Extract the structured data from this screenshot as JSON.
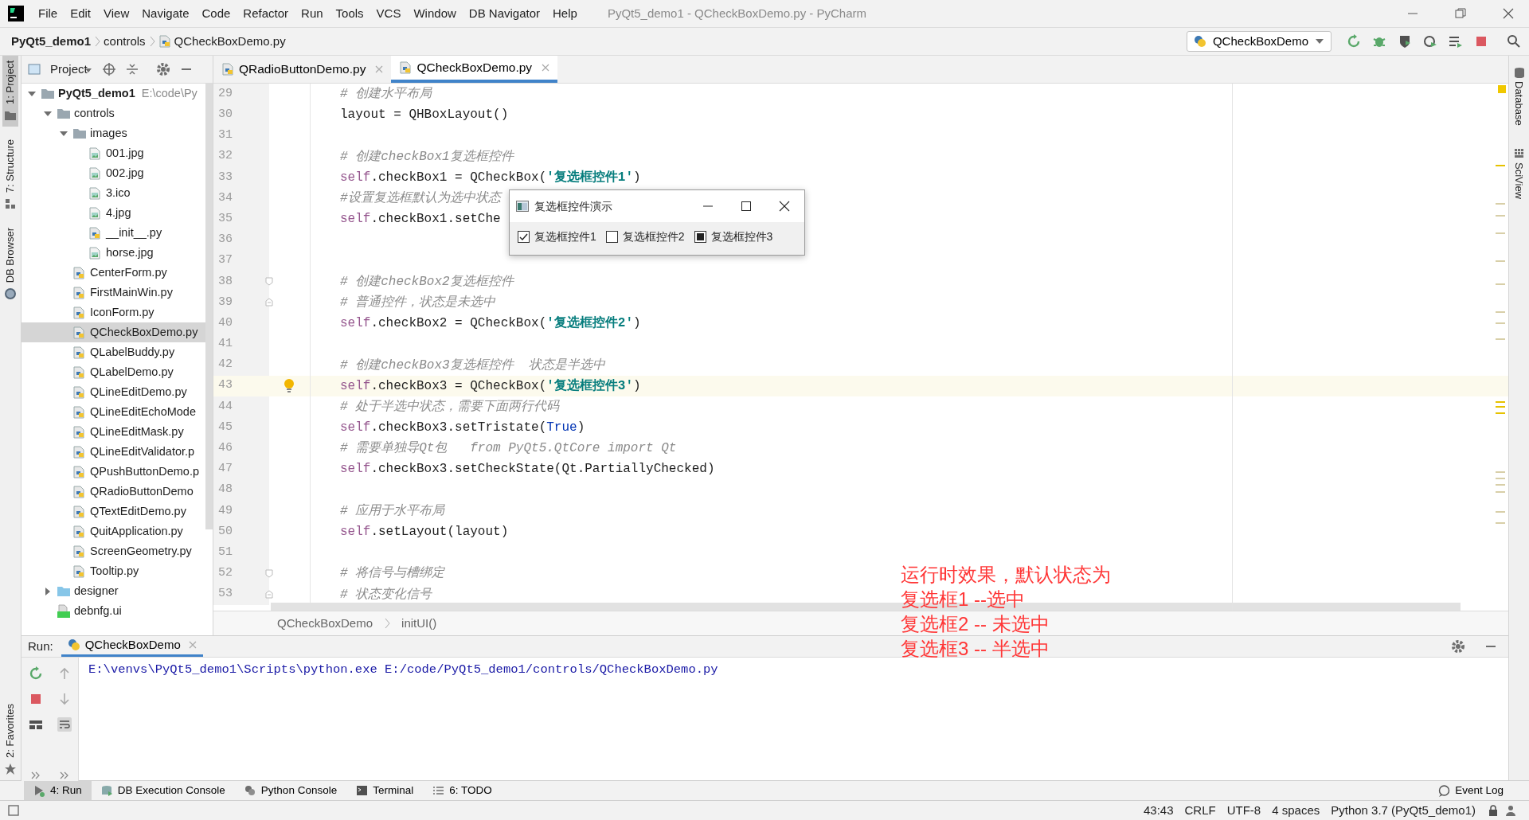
{
  "window": {
    "title": "PyQt5_demo1 - QCheckBoxDemo.py - PyCharm"
  },
  "menu": [
    "File",
    "Edit",
    "View",
    "Navigate",
    "Code",
    "Refactor",
    "Run",
    "Tools",
    "VCS",
    "Window",
    "DB Navigator",
    "Help"
  ],
  "navigation": {
    "breadcrumb": [
      "PyQt5_demo1",
      "controls",
      "QCheckBoxDemo.py"
    ],
    "run_configuration": "QCheckBoxDemo"
  },
  "left_tool_strip": [
    "1: Project",
    "7: Structure",
    "DB Browser",
    "2: Favorites"
  ],
  "right_tool_strip": [
    "Database",
    "SciView"
  ],
  "project_panel": {
    "title": "Project",
    "tree": [
      {
        "label": "PyQt5_demo1",
        "path": "E:\\code\\Py",
        "kind": "folder",
        "expanded": true,
        "selected": false,
        "children": [
          {
            "label": "controls",
            "kind": "folder",
            "expanded": true,
            "selected": false,
            "children": [
              {
                "label": "images",
                "kind": "folder",
                "expanded": true,
                "selected": false,
                "children": [
                  {
                    "label": "001.jpg",
                    "kind": "image",
                    "selected": false
                  },
                  {
                    "label": "002.jpg",
                    "kind": "image",
                    "selected": false
                  },
                  {
                    "label": "3.ico",
                    "kind": "image",
                    "selected": false
                  },
                  {
                    "label": "4.jpg",
                    "kind": "image",
                    "selected": false
                  },
                  {
                    "label": "__init__.py",
                    "kind": "python",
                    "selected": false
                  },
                  {
                    "label": "horse.jpg",
                    "kind": "image",
                    "selected": false
                  }
                ]
              },
              {
                "label": "CenterForm.py",
                "kind": "python",
                "selected": false
              },
              {
                "label": "FirstMainWin.py",
                "kind": "python",
                "selected": false
              },
              {
                "label": "IconForm.py",
                "kind": "python",
                "selected": false
              },
              {
                "label": "QCheckBoxDemo.py",
                "kind": "python",
                "selected": true
              },
              {
                "label": "QLabelBuddy.py",
                "kind": "python",
                "selected": false
              },
              {
                "label": "QLabelDemo.py",
                "kind": "python",
                "selected": false
              },
              {
                "label": "QLineEditDemo.py",
                "kind": "python",
                "selected": false
              },
              {
                "label": "QLineEditEchoMode",
                "kind": "python",
                "selected": false
              },
              {
                "label": "QLineEditMask.py",
                "kind": "python",
                "selected": false
              },
              {
                "label": "QLineEditValidator.p",
                "kind": "python",
                "selected": false
              },
              {
                "label": "QPushButtonDemo.p",
                "kind": "python",
                "selected": false
              },
              {
                "label": "QRadioButtonDemo",
                "kind": "python",
                "selected": false
              },
              {
                "label": "QTextEditDemo.py",
                "kind": "python",
                "selected": false
              },
              {
                "label": "QuitApplication.py",
                "kind": "python",
                "selected": false
              },
              {
                "label": "ScreenGeometry.py",
                "kind": "python",
                "selected": false
              },
              {
                "label": "Tooltip.py",
                "kind": "python",
                "selected": false
              }
            ]
          },
          {
            "label": "designer",
            "kind": "folder",
            "expanded": false,
            "selected": false
          },
          {
            "label": "debnfg.ui",
            "kind": "qt",
            "selected": false
          }
        ]
      }
    ]
  },
  "editor_tabs": [
    {
      "label": "QRadioButtonDemo.py",
      "selected": false
    },
    {
      "label": "QCheckBoxDemo.py",
      "selected": true
    }
  ],
  "code_lines": [
    {
      "number": "29",
      "current": false,
      "segments": [
        {
          "kind": "comment",
          "text": "# 创建水平布局"
        }
      ]
    },
    {
      "number": "30",
      "current": false,
      "segments": [
        {
          "kind": "plain",
          "text": "layout = QHBoxLayout()"
        }
      ]
    },
    {
      "number": "31",
      "current": false
    },
    {
      "number": "32",
      "current": false,
      "segments": [
        {
          "kind": "comment",
          "text": "# 创建checkBox1复选框控件"
        }
      ]
    },
    {
      "number": "33",
      "current": false,
      "segments": [
        {
          "kind": "self",
          "text": "self"
        },
        {
          "kind": "plain",
          "text": ".checkBox1 = QCheckBox("
        },
        {
          "kind": "string",
          "text": "'复选框控件1'"
        },
        {
          "kind": "plain",
          "text": ")"
        }
      ]
    },
    {
      "number": "34",
      "current": false,
      "segments": [
        {
          "kind": "comment",
          "text": "#设置复选框默认为选中状态"
        }
      ]
    },
    {
      "number": "35",
      "current": false,
      "segments": [
        {
          "kind": "self",
          "text": "self"
        },
        {
          "kind": "plain",
          "text": ".checkBox1.setChe"
        }
      ]
    },
    {
      "number": "36",
      "current": false
    },
    {
      "number": "37",
      "current": false
    },
    {
      "number": "38",
      "current": false,
      "kind": "fold_start",
      "segments": [
        {
          "kind": "comment",
          "text": "# 创建checkBox2复选框控件"
        }
      ]
    },
    {
      "number": "39",
      "current": false,
      "kind": "fold_end",
      "segments": [
        {
          "kind": "comment",
          "text": "# 普通控件，状态是未选中"
        }
      ]
    },
    {
      "number": "40",
      "current": false,
      "segments": [
        {
          "kind": "self",
          "text": "self"
        },
        {
          "kind": "plain",
          "text": ".checkBox2 = QCheckBox("
        },
        {
          "kind": "string",
          "text": "'复选框控件2'"
        },
        {
          "kind": "plain",
          "text": ")"
        }
      ]
    },
    {
      "number": "41",
      "current": false
    },
    {
      "number": "42",
      "current": false,
      "segments": [
        {
          "kind": "comment",
          "text": "# 创建checkBox3复选框控件  状态是半选中"
        }
      ]
    },
    {
      "number": "43",
      "current": true,
      "segments": [
        {
          "kind": "self",
          "text": "self"
        },
        {
          "kind": "plain",
          "text": ".checkBox3 = QCheckBox("
        },
        {
          "kind": "string",
          "text": "'复选框控件3'"
        },
        {
          "kind": "plain",
          "text": ")"
        }
      ]
    },
    {
      "number": "44",
      "current": false,
      "segments": [
        {
          "kind": "comment",
          "text": "# 处于半选中状态，需要下面两行代码"
        }
      ]
    },
    {
      "number": "45",
      "current": false,
      "segments": [
        {
          "kind": "self",
          "text": "self"
        },
        {
          "kind": "plain",
          "text": ".checkBox3.setTristate("
        },
        {
          "kind": "keyword",
          "text": "True"
        },
        {
          "kind": "plain",
          "text": ")"
        }
      ]
    },
    {
      "number": "46",
      "current": false,
      "segments": [
        {
          "kind": "comment",
          "text": "# 需要单独导Qt包   from PyQt5.QtCore import Qt"
        }
      ]
    },
    {
      "number": "47",
      "current": false,
      "segments": [
        {
          "kind": "self",
          "text": "self"
        },
        {
          "kind": "plain",
          "text": ".checkBox3.setCheckState(Qt.PartiallyChecked)"
        }
      ]
    },
    {
      "number": "48",
      "current": false
    },
    {
      "number": "49",
      "current": false,
      "segments": [
        {
          "kind": "comment",
          "text": "# 应用于水平布局"
        }
      ]
    },
    {
      "number": "50",
      "current": false,
      "segments": [
        {
          "kind": "self",
          "text": "self"
        },
        {
          "kind": "plain",
          "text": ".setLayout(layout)"
        }
      ]
    },
    {
      "number": "51",
      "current": false
    },
    {
      "number": "52",
      "current": false,
      "kind": "fold_start",
      "segments": [
        {
          "kind": "comment",
          "text": "# 将信号与槽绑定"
        }
      ]
    },
    {
      "number": "53",
      "current": false,
      "kind": "fold_end",
      "segments": [
        {
          "kind": "comment",
          "text": "# 状态变化信号"
        }
      ]
    }
  ],
  "editor_breadcrumb": [
    "QCheckBoxDemo",
    "initUI()"
  ],
  "run_panel": {
    "label": "Run:",
    "tab": "QCheckBoxDemo",
    "output": "E:\\venvs\\PyQt5_demo1\\Scripts\\python.exe E:/code/PyQt5_demo1/controls/QCheckBoxDemo.py"
  },
  "bottom_tabs": [
    {
      "label": "4: Run",
      "selected": true
    },
    {
      "label": "DB Execution Console",
      "selected": false
    },
    {
      "label": "Python Console",
      "selected": false
    },
    {
      "label": "Terminal",
      "selected": false
    },
    {
      "label": "6: TODO",
      "selected": false
    }
  ],
  "event_log": "Event Log",
  "status_bar": [
    "43:43",
    "CRLF",
    "UTF-8",
    "4 spaces",
    "Python 3.7 (PyQt5_demo1)"
  ],
  "dialog": {
    "title": "复选框控件演示",
    "checkboxes": [
      {
        "label": "复选框控件1",
        "kind": "checked"
      },
      {
        "label": "复选框控件2",
        "kind": "unchecked"
      },
      {
        "label": "复选框控件3",
        "kind": "partial"
      }
    ]
  },
  "annotation": [
    "运行时效果，默认状态为",
    "复选框1 --选中",
    "复选框2 -- 未选中",
    "复选框3 -- 半选中"
  ]
}
